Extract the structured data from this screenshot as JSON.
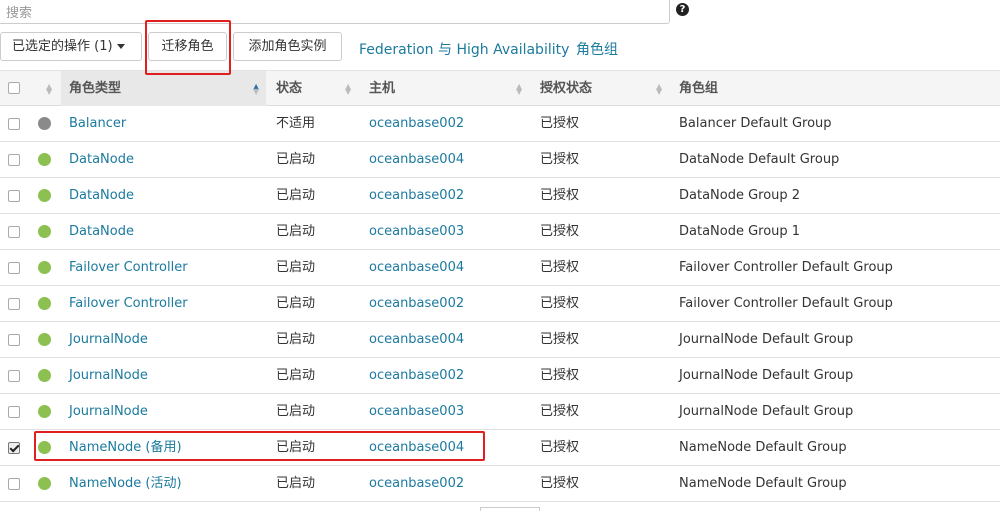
{
  "search": {
    "placeholder": "搜索",
    "help_icon": "question-circle-icon"
  },
  "toolbar": {
    "actions_label": "已选定的操作 (1)",
    "migrate_label": "迁移角色",
    "add_instance_label": "添加角色实例",
    "federation_link": "Federation 与 High Availability",
    "role_groups_link": "角色组"
  },
  "table": {
    "headers": {
      "role_type": "角色类型",
      "status": "状态",
      "host": "主机",
      "auth_status": "授权状态",
      "role_group": "角色组"
    },
    "sorted_column": "role_type",
    "rows": [
      {
        "checked": false,
        "health": "gray",
        "role": "Balancer",
        "status": "不适用",
        "host": "oceanbase002",
        "auth": "已授权",
        "group": "Balancer Default Group"
      },
      {
        "checked": false,
        "health": "green",
        "role": "DataNode",
        "status": "已启动",
        "host": "oceanbase004",
        "auth": "已授权",
        "group": "DataNode Default Group"
      },
      {
        "checked": false,
        "health": "green",
        "role": "DataNode",
        "status": "已启动",
        "host": "oceanbase002",
        "auth": "已授权",
        "group": "DataNode Group 2"
      },
      {
        "checked": false,
        "health": "green",
        "role": "DataNode",
        "status": "已启动",
        "host": "oceanbase003",
        "auth": "已授权",
        "group": "DataNode Group 1"
      },
      {
        "checked": false,
        "health": "green",
        "role": "Failover Controller",
        "status": "已启动",
        "host": "oceanbase004",
        "auth": "已授权",
        "group": "Failover Controller Default Group"
      },
      {
        "checked": false,
        "health": "green",
        "role": "Failover Controller",
        "status": "已启动",
        "host": "oceanbase002",
        "auth": "已授权",
        "group": "Failover Controller Default Group"
      },
      {
        "checked": false,
        "health": "green",
        "role": "JournalNode",
        "status": "已启动",
        "host": "oceanbase004",
        "auth": "已授权",
        "group": "JournalNode Default Group"
      },
      {
        "checked": false,
        "health": "green",
        "role": "JournalNode",
        "status": "已启动",
        "host": "oceanbase002",
        "auth": "已授权",
        "group": "JournalNode Default Group"
      },
      {
        "checked": false,
        "health": "green",
        "role": "JournalNode",
        "status": "已启动",
        "host": "oceanbase003",
        "auth": "已授权",
        "group": "JournalNode Default Group"
      },
      {
        "checked": true,
        "health": "green",
        "role": "NameNode (备用)",
        "status": "已启动",
        "host": "oceanbase004",
        "auth": "已授权",
        "group": "NameNode Default Group"
      },
      {
        "checked": false,
        "health": "green",
        "role": "NameNode (活动)",
        "status": "已启动",
        "host": "oceanbase002",
        "auth": "已授权",
        "group": "NameNode Default Group"
      }
    ]
  },
  "colors": {
    "link": "#1b7a9e",
    "health_green": "#8cc152",
    "health_gray": "#8a8a8a",
    "highlight_red": "#e0201e"
  }
}
